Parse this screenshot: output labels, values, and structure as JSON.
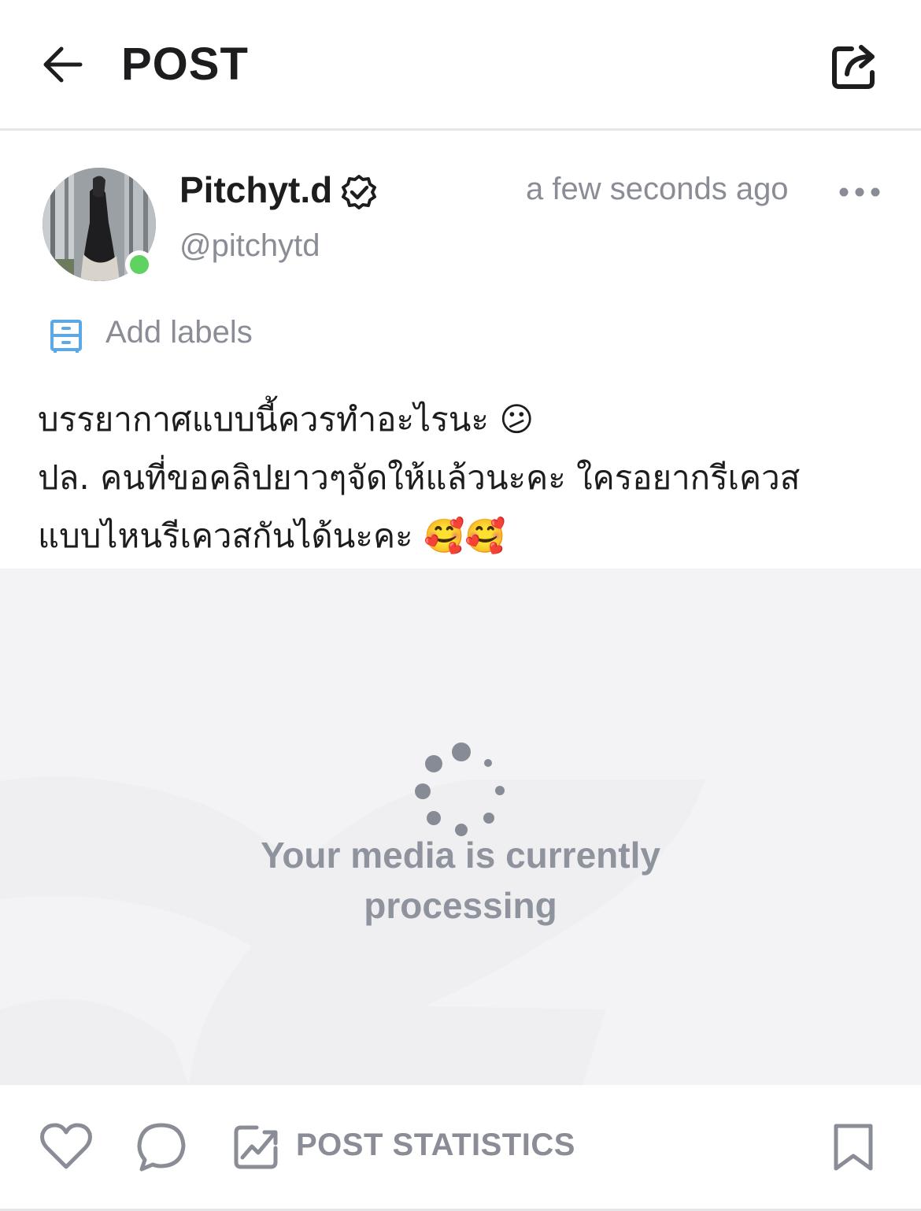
{
  "header": {
    "title": "POST",
    "back_icon": "arrow-left-icon",
    "share_icon": "share-icon"
  },
  "post": {
    "author": {
      "display_name": "Pitchyt.d",
      "handle": "@pitchytd",
      "verified_icon": "verified-badge-icon",
      "online": true
    },
    "timestamp": "a few seconds ago",
    "more_icon": "more-dots-icon",
    "labels": {
      "icon": "label-icon",
      "text": "Add labels"
    },
    "text_lines": [
      "บรรยากาศแบบนี้ควรทำอะไรนะ 😕",
      "ปล. คนที่ขอคลิปยาวๆจัดให้แล้วนะคะ ใครอยากรีเควส",
      "แบบไหนรีเควสกันได้นะคะ 🥰🥰"
    ],
    "media": {
      "status_line1": "Your media is currently",
      "status_line2": "processing"
    }
  },
  "actions": {
    "like_icon": "heart-icon",
    "comment_icon": "comment-icon",
    "stats_icon": "chart-icon",
    "stats_label": "POST STATISTICS",
    "bookmark_icon": "bookmark-icon"
  },
  "colors": {
    "accent_blue": "#5aa9e6",
    "online_green": "#5fd262",
    "muted_text": "#8a8d96",
    "media_bg": "#f3f3f5"
  }
}
